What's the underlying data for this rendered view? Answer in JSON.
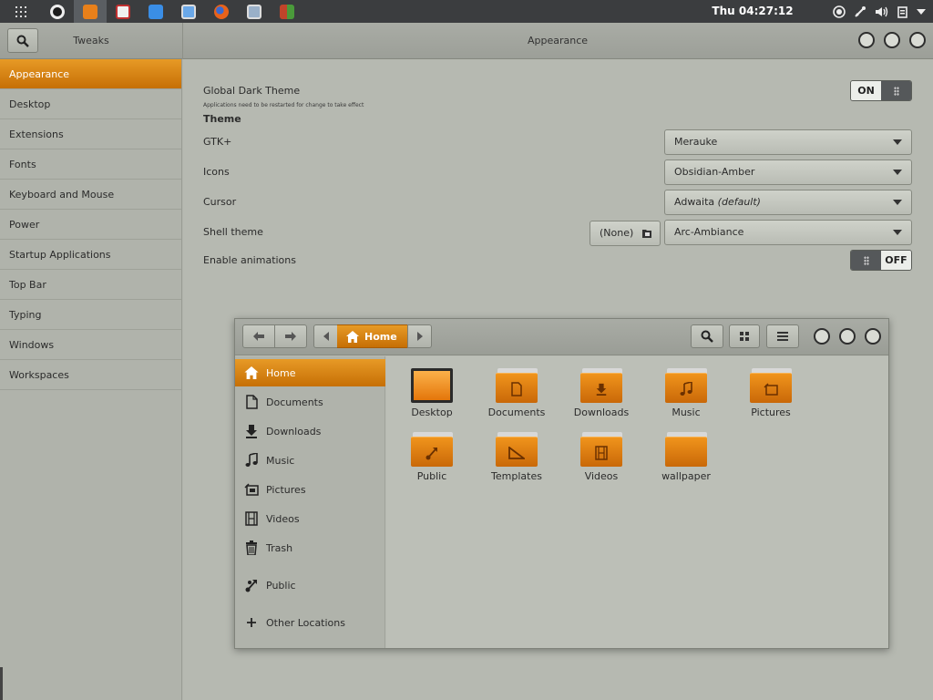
{
  "topbar": {
    "clock": "Thu 04:27:12",
    "apps": [
      {
        "name": "app-1",
        "color": "#ffffff",
        "active": false
      },
      {
        "name": "files-app",
        "color": "#e8801a",
        "active": true
      },
      {
        "name": "app-3",
        "color": "#f0f0f0",
        "active": false
      },
      {
        "name": "app-4",
        "color": "#3a8ee6",
        "active": false
      },
      {
        "name": "app-5",
        "color": "#6aa8e8",
        "active": false
      },
      {
        "name": "firefox-app",
        "color": "#e8621a",
        "active": false
      },
      {
        "name": "app-7",
        "color": "#9ab0c8",
        "active": false
      },
      {
        "name": "app-8",
        "color": "#c0442a",
        "active": false
      }
    ]
  },
  "tweaks": {
    "side_title": "Tweaks",
    "main_title": "Appearance",
    "sidebar": [
      "Appearance",
      "Desktop",
      "Extensions",
      "Fonts",
      "Keyboard and Mouse",
      "Power",
      "Startup Applications",
      "Top Bar",
      "Typing",
      "Windows",
      "Workspaces"
    ],
    "global_dark_theme": {
      "label": "Global Dark Theme",
      "note": "Applications need to be restarted for change to take effect",
      "state": "ON"
    },
    "theme_heading": "Theme",
    "gtk": {
      "label": "GTK+",
      "value": "Merauke"
    },
    "icons": {
      "label": "Icons",
      "value": "Obsidian-Amber"
    },
    "cursor": {
      "label": "Cursor",
      "value": "Adwaita",
      "suffix": "(default)"
    },
    "shell": {
      "label": "Shell theme",
      "none_label": "(None)",
      "value": "Arc-Ambiance"
    },
    "animations": {
      "label": "Enable animations",
      "state": "OFF"
    }
  },
  "files": {
    "path": "Home",
    "sidebar": [
      {
        "label": "Home",
        "icon": "home-icon"
      },
      {
        "label": "Documents",
        "icon": "document-icon"
      },
      {
        "label": "Downloads",
        "icon": "download-icon"
      },
      {
        "label": "Music",
        "icon": "music-icon"
      },
      {
        "label": "Pictures",
        "icon": "pictures-icon"
      },
      {
        "label": "Videos",
        "icon": "film-icon"
      },
      {
        "label": "Trash",
        "icon": "trash-icon"
      },
      {
        "label": "Public",
        "icon": "share-icon"
      },
      {
        "label": "Other Locations",
        "icon": "plus-icon"
      }
    ],
    "items": [
      "Desktop",
      "Documents",
      "Downloads",
      "Music",
      "Pictures",
      "Public",
      "Templates",
      "Videos",
      "wallpaper"
    ]
  },
  "colors": {
    "accent": "#d97a0e",
    "panel": "#3b3d3f"
  }
}
